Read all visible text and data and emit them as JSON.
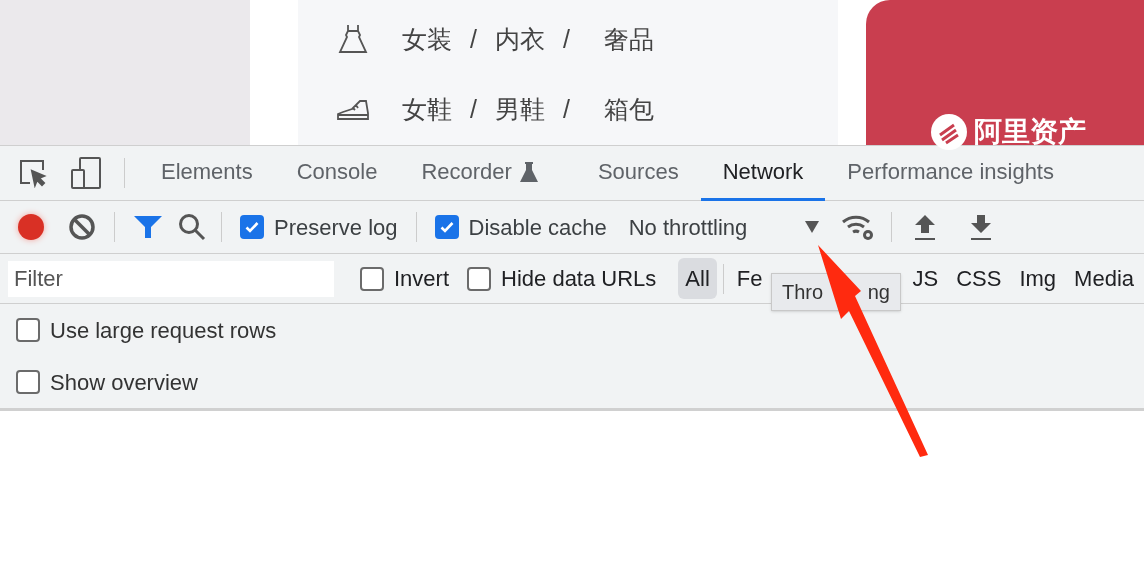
{
  "page": {
    "categories": [
      {
        "kind": "dress",
        "links": [
          "女装",
          "内衣",
          "奢品"
        ],
        "separator": "/"
      },
      {
        "kind": "shoe",
        "links": [
          "女鞋",
          "男鞋",
          "箱包"
        ],
        "separator": "/"
      }
    ],
    "banner": {
      "logo": "阿里资产"
    }
  },
  "devtools": {
    "tabs": [
      {
        "label": "Elements",
        "selected": false,
        "experimental": false
      },
      {
        "label": "Console",
        "selected": false,
        "experimental": false
      },
      {
        "label": "Recorder",
        "selected": false,
        "experimental": true
      },
      {
        "label": "Sources",
        "selected": false,
        "experimental": false
      },
      {
        "label": "Network",
        "selected": true,
        "experimental": false
      },
      {
        "label": "Performance insights",
        "selected": false,
        "experimental": false
      }
    ],
    "toolbar": {
      "recording": true,
      "filter_active": true,
      "preserve_log": {
        "label": "Preserve log",
        "checked": true
      },
      "disable_cache": {
        "label": "Disable cache",
        "checked": true
      },
      "throttling": "No throttling"
    },
    "filter": {
      "placeholder": "Filter",
      "options": [
        {
          "label": "Invert",
          "checked": false
        },
        {
          "label": "Hide data URLs",
          "checked": false
        }
      ],
      "types": [
        {
          "label": "All",
          "selected": true
        },
        {
          "label": "Fe",
          "selected": false
        },
        {
          "label": "JS",
          "selected": false
        },
        {
          "label": "CSS",
          "selected": false
        },
        {
          "label": "Img",
          "selected": false
        },
        {
          "label": "Media",
          "selected": false
        }
      ]
    },
    "settings": [
      {
        "label": "Use large request rows",
        "checked": false
      },
      {
        "label": "Show overview",
        "checked": false
      }
    ],
    "tooltip": {
      "parts": [
        "Thro",
        "ng"
      ]
    }
  }
}
